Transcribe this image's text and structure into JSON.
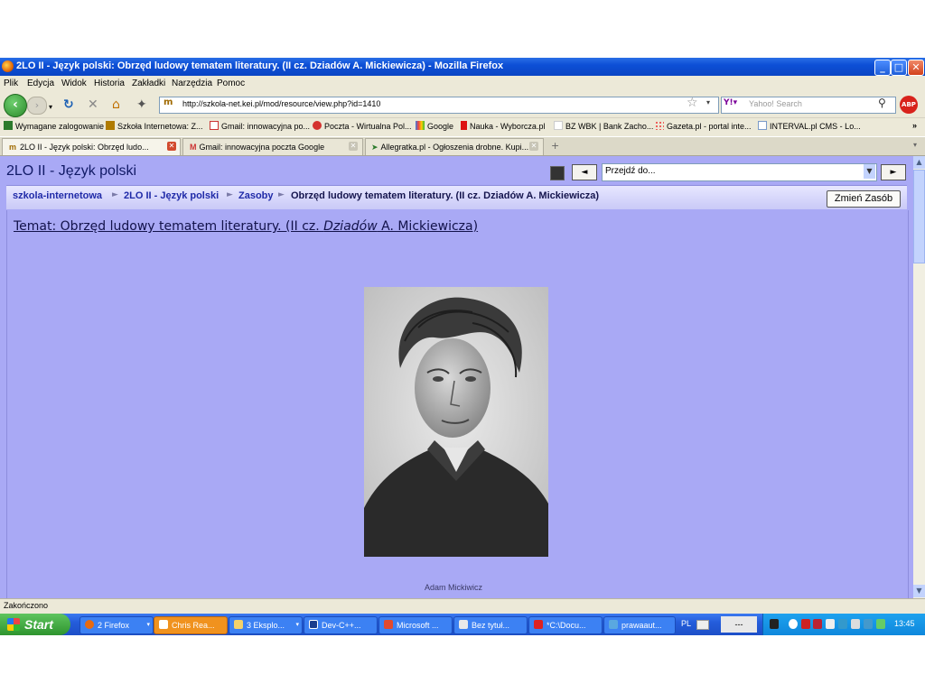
{
  "window": {
    "title": "2LO II - Język polski: Obrzęd ludowy tematem literatury. (II cz. Dziadów A. Mickiewicza) - Mozilla Firefox"
  },
  "menu": [
    "Plik",
    "Edycja",
    "Widok",
    "Historia",
    "Zakładki",
    "Narzędzia",
    "Pomoc"
  ],
  "nav": {
    "url": "http://szkola-net.kei.pl/mod/resource/view.php?id=1410",
    "search_placeholder": "Yahoo! Search",
    "abp": "ABP"
  },
  "bookmarks": [
    "Wymagane zalogowanie",
    "Szkoła Internetowa: Z...",
    "Gmail: innowacyjna po...",
    "Poczta - Wirtualna Pol...",
    "Google",
    "Nauka - Wyborcza.pl",
    "BZ WBK | Bank Zacho...",
    "Gazeta.pl - portal inte...",
    "INTERVAL.pl CMS - Lo...",
    "»"
  ],
  "tabs": [
    "2LO II - Język polski: Obrzęd ludo...",
    "Gmail: innowacyjna poczta Google",
    "Allegratka.pl - Ogłoszenia drobne. Kupi..."
  ],
  "page": {
    "heading": "2LO II - Język polski",
    "jump_placeholder": "Przejdź do...",
    "prev": "◄",
    "next": "►",
    "breadcrumb": [
      "szkola-internetowa",
      "2LO II - Język polski",
      "Zasoby",
      "Obrzęd ludowy tematem literatury. (II cz. Dziadów A. Mickiewicza)"
    ],
    "change_button": "Zmień Zasób",
    "topic_prefix": "Temat: Obrzęd ludowy tematem literatury. (II cz. ",
    "topic_italic": "Dziadów",
    "topic_suffix": " A. Mickiewicza)",
    "caption": "Adam Mickiwicz"
  },
  "status": "Zakończono",
  "taskbar": {
    "start": "Start",
    "tasks": [
      "2 Firefox",
      "Chris Rea...",
      "3 Eksplo...",
      "Dev-C++...",
      "Microsoft ...",
      "Bez tytuł...",
      "*C:\\Docu...",
      "prawaaut..."
    ],
    "lang": "PL",
    "dashes": "---",
    "clock": "13:45"
  },
  "colors": {
    "page_bg": "#a9a9f5",
    "titlebar": "#0d4fd6",
    "taskbar": "#245ddb",
    "tray": "#0f87dc"
  }
}
